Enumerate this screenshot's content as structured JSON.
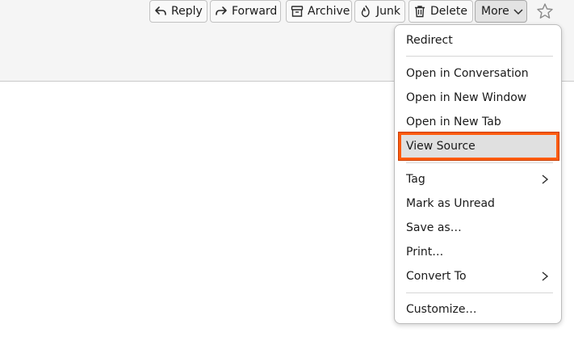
{
  "toolbar": {
    "reply_label": "Reply",
    "forward_label": "Forward",
    "archive_label": "Archive",
    "junk_label": "Junk",
    "delete_label": "Delete",
    "more_label": "More"
  },
  "menu": {
    "items": [
      {
        "label": "Redirect"
      },
      {
        "label": "Open in Conversation",
        "accesskey": "C"
      },
      {
        "label": "Open in New Window",
        "accesskey": "W"
      },
      {
        "label": "Open in New Tab",
        "accesskey": "T"
      },
      {
        "label": "View Source",
        "accesskey": "V",
        "highlighted": true
      },
      {
        "label": "Tag",
        "accesskey": "g",
        "submenu": true
      },
      {
        "label": "Mark as Unread",
        "accesskey": "r"
      },
      {
        "label": "Save as…",
        "accesskey": "S"
      },
      {
        "label": "Print…",
        "accesskey": "P"
      },
      {
        "label": "Convert To",
        "accesskey": "n",
        "submenu": true
      },
      {
        "label": "Customize…"
      }
    ]
  },
  "colors": {
    "highlight_border": "#ff5c0f",
    "highlight_fill": "#e0e0e0"
  }
}
